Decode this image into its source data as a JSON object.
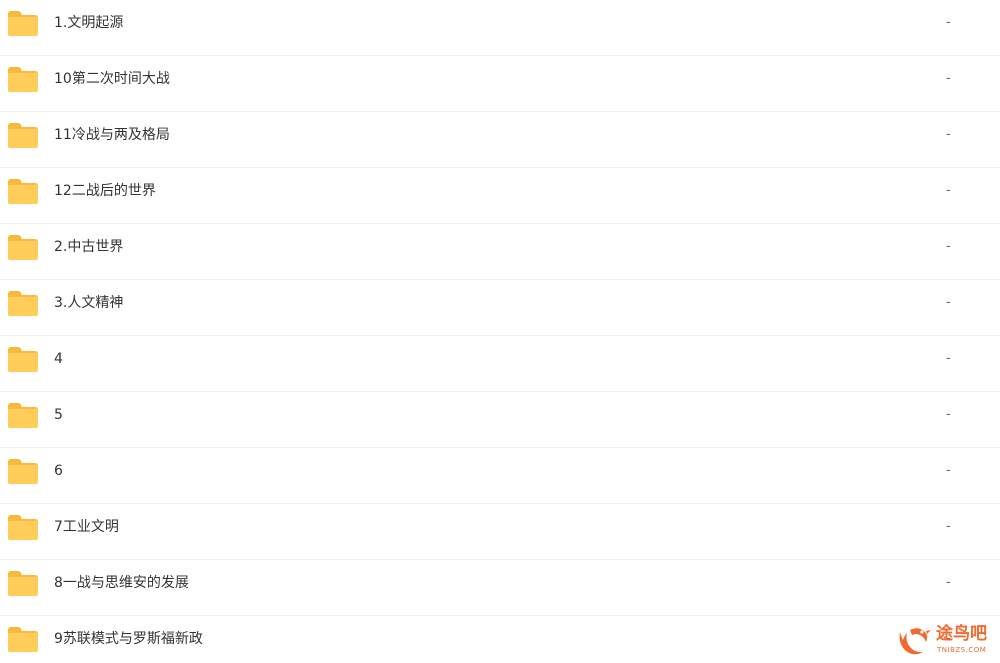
{
  "folder_icon": "folder-icon",
  "colors": {
    "folder_body": "#ffcd59",
    "folder_tab": "#f8b93d",
    "watermark": "#f26a2e"
  },
  "files": [
    {
      "name": "1.文明起源",
      "size": "-"
    },
    {
      "name": "10第二次时间大战",
      "size": "-"
    },
    {
      "name": "11冷战与两及格局",
      "size": "-"
    },
    {
      "name": "12二战后的世界",
      "size": "-"
    },
    {
      "name": "2.中古世界",
      "size": "-"
    },
    {
      "name": "3.人文精神",
      "size": "-"
    },
    {
      "name": "4",
      "size": "-"
    },
    {
      "name": "5",
      "size": "-"
    },
    {
      "name": "6",
      "size": "-"
    },
    {
      "name": "7工业文明",
      "size": "-"
    },
    {
      "name": "8一战与思维安的发展",
      "size": "-"
    },
    {
      "name": "9苏联模式与罗斯福新政",
      "size": "-"
    }
  ],
  "watermark": {
    "title": "途鸟吧",
    "subtitle": "TNIBZS.COM"
  }
}
